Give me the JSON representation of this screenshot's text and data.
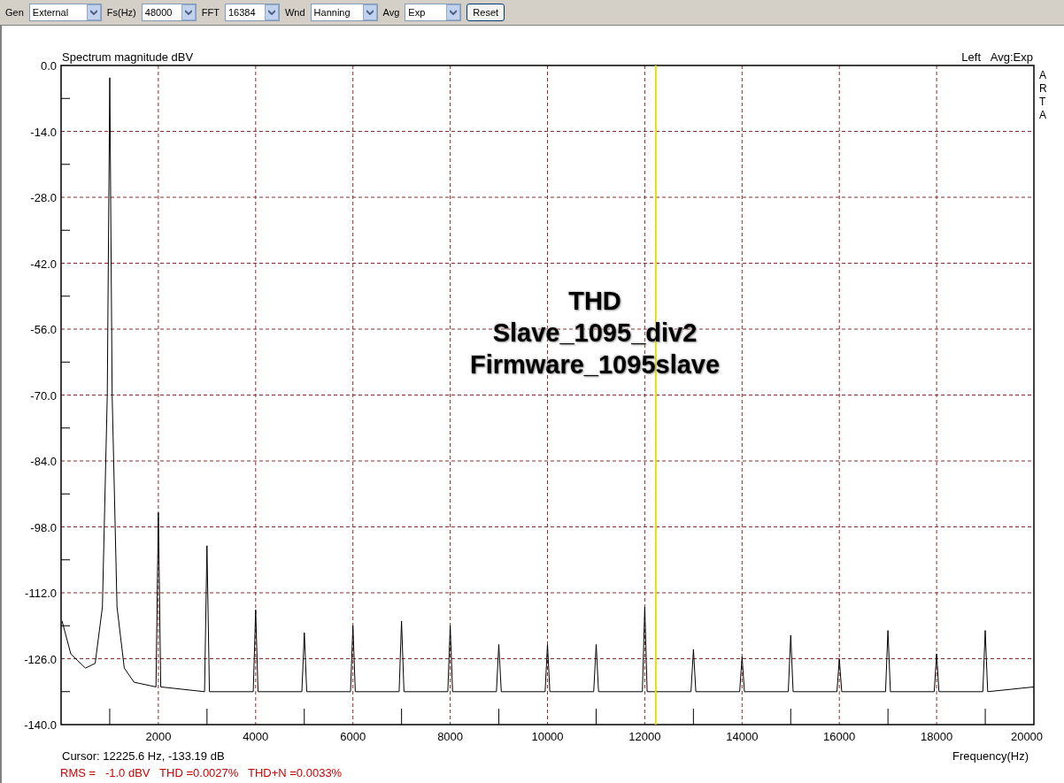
{
  "toolbar": {
    "controls": [
      {
        "label": "Gen",
        "value": "External"
      },
      {
        "label": "Fs(Hz)",
        "value": "48000"
      },
      {
        "label": "FFT",
        "value": "16384"
      },
      {
        "label": "Wnd",
        "value": "Hanning"
      },
      {
        "label": "Avg",
        "value": "Exp"
      }
    ],
    "button": "Reset"
  },
  "plot": {
    "avg_info": "Avg:Exp",
    "brand": "ARTA",
    "overlay_lines": [
      "THD",
      "Slave_1095_div2",
      "Firmware_1095slave"
    ],
    "cursor_readout": "Cursor: 12225.6 Hz, -133.19 dB",
    "measurements": "RMS =   -1.0 dBV   THD =0.0027%   THD+N =0.0033%",
    "chart_data": {
      "type": "line",
      "xlabel": "Frequency(Hz)",
      "ylabel": "Spectrum magnitude dBV",
      "xlim": [
        0,
        20000
      ],
      "ylim": [
        -140,
        0
      ],
      "xticks": [
        2000,
        4000,
        6000,
        8000,
        10000,
        12000,
        14000,
        16000,
        18000,
        20000
      ],
      "yticks": [
        {
          "value": 0,
          "label": "0.0"
        },
        {
          "value": -14,
          "label": "-14.0"
        },
        {
          "value": -28,
          "label": "-28.0"
        },
        {
          "value": -42,
          "label": "-42.0"
        },
        {
          "value": -56,
          "label": "-56.0"
        },
        {
          "value": -70,
          "label": "-70.0"
        },
        {
          "value": -84,
          "label": "-84.0"
        },
        {
          "value": -98,
          "label": "-98.0"
        },
        {
          "value": -112,
          "label": "-112.0"
        },
        {
          "value": -126,
          "label": "-126.0"
        },
        {
          "value": -140,
          "label": "-140.0"
        }
      ],
      "x": [
        20,
        200,
        500,
        700,
        850,
        950,
        1000,
        1050,
        1150,
        1300,
        1500,
        1950,
        2000,
        2050,
        2950,
        3000,
        3050,
        3950,
        4000,
        4050,
        4950,
        5000,
        5050,
        5950,
        6000,
        6050,
        6950,
        7000,
        7050,
        7950,
        8000,
        8050,
        8950,
        9000,
        9050,
        9950,
        10000,
        10050,
        10950,
        11000,
        11050,
        11950,
        12000,
        12050,
        12950,
        13000,
        13050,
        13950,
        14000,
        14050,
        14950,
        15000,
        15050,
        15950,
        16000,
        16050,
        16950,
        17000,
        17050,
        17950,
        18000,
        18050,
        18950,
        19000,
        19050,
        20000
      ],
      "series": [
        {
          "name": "Left",
          "color": "#000000",
          "values": [
            -118,
            -125,
            -128,
            -127,
            -115,
            -70,
            -2.6,
            -70,
            -115,
            -128,
            -131,
            -132,
            -95,
            -132,
            -133,
            -102,
            -133,
            -133,
            -115.6,
            -133,
            -133,
            -120.5,
            -133,
            -133,
            -119,
            -133,
            -133,
            -118,
            -133,
            -133,
            -119,
            -133,
            -133,
            -123,
            -133,
            -133,
            -123,
            -133,
            -133,
            -123,
            -133,
            -133,
            -115,
            -133,
            -133,
            -124,
            -133,
            -133,
            -125.6,
            -133,
            -133,
            -121,
            -133,
            -133,
            -126,
            -133,
            -133,
            -120,
            -133,
            -133,
            -125,
            -133,
            -133,
            -120,
            -133,
            -132
          ]
        }
      ],
      "grid": true,
      "ref_lines": [
        {
          "axis": "x",
          "value": 12225.6,
          "color": "#e0e000"
        }
      ]
    }
  }
}
